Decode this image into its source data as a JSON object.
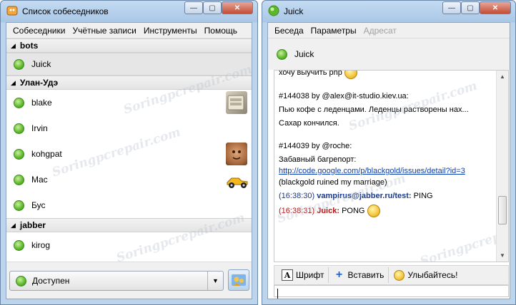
{
  "roster_window": {
    "title": "Список собеседников",
    "menu": [
      "Собеседники",
      "Учётные записи",
      "Инструменты",
      "Помощь"
    ],
    "groups": [
      {
        "name": "bots",
        "contacts": [
          {
            "name": "Juick",
            "selected": true,
            "avatar": ""
          }
        ]
      },
      {
        "name": "Улан-Удэ",
        "contacts": [
          {
            "name": "blake",
            "selected": false,
            "avatar": "keyboard-avatar"
          },
          {
            "name": "Irvin",
            "selected": false,
            "avatar": ""
          },
          {
            "name": "kohgpat",
            "selected": false,
            "avatar": "face-avatar"
          },
          {
            "name": "Mac",
            "selected": false,
            "avatar": "racecar-avatar"
          },
          {
            "name": "Бус",
            "selected": false,
            "avatar": ""
          }
        ]
      },
      {
        "name": "jabber",
        "contacts": [
          {
            "name": "kirog",
            "selected": false,
            "avatar": ""
          }
        ]
      }
    ],
    "status": {
      "label": "Доступен",
      "color": "#5cb82a"
    }
  },
  "chat_window": {
    "title": "Juick",
    "menu": [
      "Беседа",
      "Параметры",
      "Адресат"
    ],
    "menu_disabled": [
      false,
      false,
      true
    ],
    "contact": "Juick",
    "log": {
      "top_cut": "хочу выучить php",
      "m1_header": "#144038 by @alex@it-studio.kiev.ua:",
      "m1_line1": "Пью кофе с леденцами. Леденцы растворены нах...",
      "m1_line2": "Сахар кончился.",
      "m2_header": "#144039 by @roche:",
      "m2_prefix": "Забавный багрепорт: ",
      "m2_link": "http://code.google.com/p/blackgold/issues/detail?id=3",
      "m2_suffix": " (blackgold ruined my marriage)",
      "out_time": "(16:38:30)",
      "out_nick": "vampirus@jabber.ru/test:",
      "out_text": "PING",
      "in_time": "(16:38:31)",
      "in_nick": "Juick:",
      "in_text": "PONG"
    },
    "toolbar": {
      "font": "Шрифт",
      "insert": "Вставить",
      "smile": "Улыбайтесь!"
    }
  },
  "watermark": "Soringpcrepair.com",
  "colors": {
    "online": "#5cb82a",
    "link": "#0b3fb0",
    "out_nick": "#1a3a8c",
    "in_nick": "#b01515"
  }
}
